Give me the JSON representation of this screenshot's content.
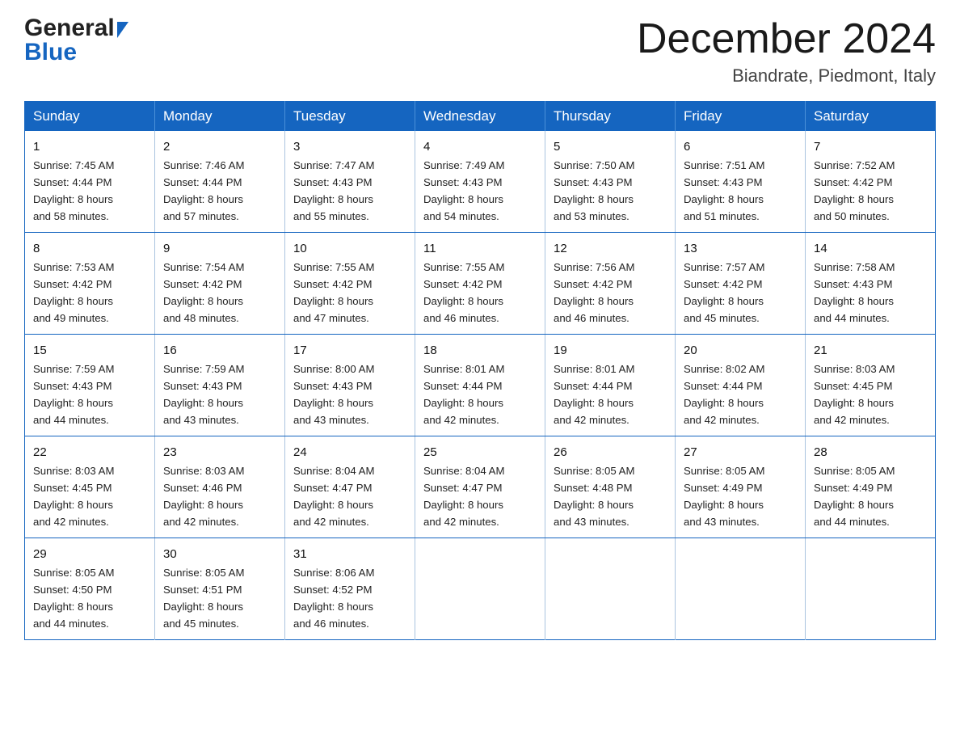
{
  "header": {
    "logo_general": "General",
    "logo_blue": "Blue",
    "month_title": "December 2024",
    "location": "Biandrate, Piedmont, Italy"
  },
  "weekdays": [
    "Sunday",
    "Monday",
    "Tuesday",
    "Wednesday",
    "Thursday",
    "Friday",
    "Saturday"
  ],
  "weeks": [
    [
      {
        "day": "1",
        "sunrise": "Sunrise: 7:45 AM",
        "sunset": "Sunset: 4:44 PM",
        "daylight": "Daylight: 8 hours",
        "minutes": "and 58 minutes."
      },
      {
        "day": "2",
        "sunrise": "Sunrise: 7:46 AM",
        "sunset": "Sunset: 4:44 PM",
        "daylight": "Daylight: 8 hours",
        "minutes": "and 57 minutes."
      },
      {
        "day": "3",
        "sunrise": "Sunrise: 7:47 AM",
        "sunset": "Sunset: 4:43 PM",
        "daylight": "Daylight: 8 hours",
        "minutes": "and 55 minutes."
      },
      {
        "day": "4",
        "sunrise": "Sunrise: 7:49 AM",
        "sunset": "Sunset: 4:43 PM",
        "daylight": "Daylight: 8 hours",
        "minutes": "and 54 minutes."
      },
      {
        "day": "5",
        "sunrise": "Sunrise: 7:50 AM",
        "sunset": "Sunset: 4:43 PM",
        "daylight": "Daylight: 8 hours",
        "minutes": "and 53 minutes."
      },
      {
        "day": "6",
        "sunrise": "Sunrise: 7:51 AM",
        "sunset": "Sunset: 4:43 PM",
        "daylight": "Daylight: 8 hours",
        "minutes": "and 51 minutes."
      },
      {
        "day": "7",
        "sunrise": "Sunrise: 7:52 AM",
        "sunset": "Sunset: 4:42 PM",
        "daylight": "Daylight: 8 hours",
        "minutes": "and 50 minutes."
      }
    ],
    [
      {
        "day": "8",
        "sunrise": "Sunrise: 7:53 AM",
        "sunset": "Sunset: 4:42 PM",
        "daylight": "Daylight: 8 hours",
        "minutes": "and 49 minutes."
      },
      {
        "day": "9",
        "sunrise": "Sunrise: 7:54 AM",
        "sunset": "Sunset: 4:42 PM",
        "daylight": "Daylight: 8 hours",
        "minutes": "and 48 minutes."
      },
      {
        "day": "10",
        "sunrise": "Sunrise: 7:55 AM",
        "sunset": "Sunset: 4:42 PM",
        "daylight": "Daylight: 8 hours",
        "minutes": "and 47 minutes."
      },
      {
        "day": "11",
        "sunrise": "Sunrise: 7:55 AM",
        "sunset": "Sunset: 4:42 PM",
        "daylight": "Daylight: 8 hours",
        "minutes": "and 46 minutes."
      },
      {
        "day": "12",
        "sunrise": "Sunrise: 7:56 AM",
        "sunset": "Sunset: 4:42 PM",
        "daylight": "Daylight: 8 hours",
        "minutes": "and 46 minutes."
      },
      {
        "day": "13",
        "sunrise": "Sunrise: 7:57 AM",
        "sunset": "Sunset: 4:42 PM",
        "daylight": "Daylight: 8 hours",
        "minutes": "and 45 minutes."
      },
      {
        "day": "14",
        "sunrise": "Sunrise: 7:58 AM",
        "sunset": "Sunset: 4:43 PM",
        "daylight": "Daylight: 8 hours",
        "minutes": "and 44 minutes."
      }
    ],
    [
      {
        "day": "15",
        "sunrise": "Sunrise: 7:59 AM",
        "sunset": "Sunset: 4:43 PM",
        "daylight": "Daylight: 8 hours",
        "minutes": "and 44 minutes."
      },
      {
        "day": "16",
        "sunrise": "Sunrise: 7:59 AM",
        "sunset": "Sunset: 4:43 PM",
        "daylight": "Daylight: 8 hours",
        "minutes": "and 43 minutes."
      },
      {
        "day": "17",
        "sunrise": "Sunrise: 8:00 AM",
        "sunset": "Sunset: 4:43 PM",
        "daylight": "Daylight: 8 hours",
        "minutes": "and 43 minutes."
      },
      {
        "day": "18",
        "sunrise": "Sunrise: 8:01 AM",
        "sunset": "Sunset: 4:44 PM",
        "daylight": "Daylight: 8 hours",
        "minutes": "and 42 minutes."
      },
      {
        "day": "19",
        "sunrise": "Sunrise: 8:01 AM",
        "sunset": "Sunset: 4:44 PM",
        "daylight": "Daylight: 8 hours",
        "minutes": "and 42 minutes."
      },
      {
        "day": "20",
        "sunrise": "Sunrise: 8:02 AM",
        "sunset": "Sunset: 4:44 PM",
        "daylight": "Daylight: 8 hours",
        "minutes": "and 42 minutes."
      },
      {
        "day": "21",
        "sunrise": "Sunrise: 8:03 AM",
        "sunset": "Sunset: 4:45 PM",
        "daylight": "Daylight: 8 hours",
        "minutes": "and 42 minutes."
      }
    ],
    [
      {
        "day": "22",
        "sunrise": "Sunrise: 8:03 AM",
        "sunset": "Sunset: 4:45 PM",
        "daylight": "Daylight: 8 hours",
        "minutes": "and 42 minutes."
      },
      {
        "day": "23",
        "sunrise": "Sunrise: 8:03 AM",
        "sunset": "Sunset: 4:46 PM",
        "daylight": "Daylight: 8 hours",
        "minutes": "and 42 minutes."
      },
      {
        "day": "24",
        "sunrise": "Sunrise: 8:04 AM",
        "sunset": "Sunset: 4:47 PM",
        "daylight": "Daylight: 8 hours",
        "minutes": "and 42 minutes."
      },
      {
        "day": "25",
        "sunrise": "Sunrise: 8:04 AM",
        "sunset": "Sunset: 4:47 PM",
        "daylight": "Daylight: 8 hours",
        "minutes": "and 42 minutes."
      },
      {
        "day": "26",
        "sunrise": "Sunrise: 8:05 AM",
        "sunset": "Sunset: 4:48 PM",
        "daylight": "Daylight: 8 hours",
        "minutes": "and 43 minutes."
      },
      {
        "day": "27",
        "sunrise": "Sunrise: 8:05 AM",
        "sunset": "Sunset: 4:49 PM",
        "daylight": "Daylight: 8 hours",
        "minutes": "and 43 minutes."
      },
      {
        "day": "28",
        "sunrise": "Sunrise: 8:05 AM",
        "sunset": "Sunset: 4:49 PM",
        "daylight": "Daylight: 8 hours",
        "minutes": "and 44 minutes."
      }
    ],
    [
      {
        "day": "29",
        "sunrise": "Sunrise: 8:05 AM",
        "sunset": "Sunset: 4:50 PM",
        "daylight": "Daylight: 8 hours",
        "minutes": "and 44 minutes."
      },
      {
        "day": "30",
        "sunrise": "Sunrise: 8:05 AM",
        "sunset": "Sunset: 4:51 PM",
        "daylight": "Daylight: 8 hours",
        "minutes": "and 45 minutes."
      },
      {
        "day": "31",
        "sunrise": "Sunrise: 8:06 AM",
        "sunset": "Sunset: 4:52 PM",
        "daylight": "Daylight: 8 hours",
        "minutes": "and 46 minutes."
      },
      null,
      null,
      null,
      null
    ]
  ]
}
